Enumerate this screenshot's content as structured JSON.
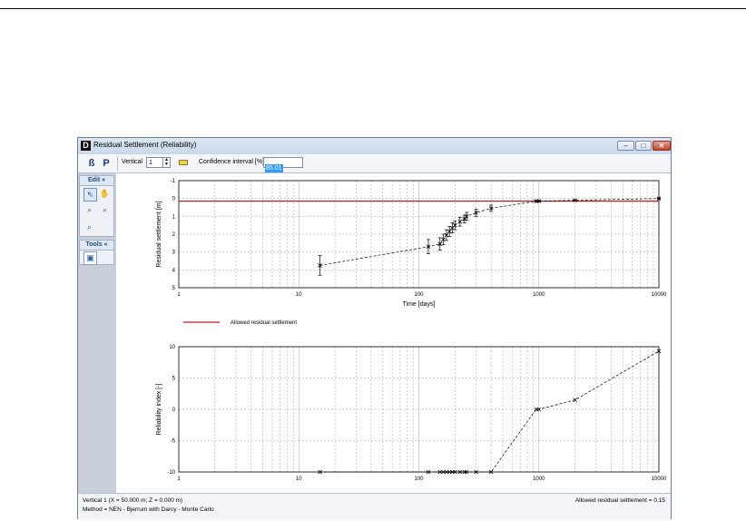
{
  "window": {
    "title": "Residual Settlement (Reliability)",
    "app_letter": "D"
  },
  "toolbar": {
    "btn1": "ß",
    "btn2": "P",
    "vertical_label": "Vertical",
    "vertical_value": "1",
    "confidence_label": "Confidence interval [%]",
    "confidence_value": "85.01"
  },
  "side": {
    "edit_title": "Edit",
    "tools_title": "Tools",
    "collapse_glyph": "«"
  },
  "status": {
    "line1": "Vertical 1 (X = 50.000 m; Z = 0.000 m)",
    "line2": "Method = NEN - Bjerrum with Darcy - Monte Carlo",
    "right": "Allowed residual settlement = 0.15"
  },
  "colors": {
    "allowed_line": "#b22222",
    "data_line": "#000000",
    "grid": "#a0a0a0"
  },
  "chart_data": [
    {
      "type": "line",
      "x_scale": "log",
      "xlabel": "Time [days]",
      "ylabel": "Residual settlement [m]",
      "xlim": [
        1,
        10000
      ],
      "ylim": [
        -1,
        5
      ],
      "y_inverted": true,
      "x_ticks": [
        "1",
        "10",
        "100",
        "1000",
        "10000"
      ],
      "y_ticks": [
        "-1",
        "0",
        "1",
        "2",
        "3",
        "4",
        "5"
      ],
      "grid": true,
      "legend": [
        {
          "name": "Allowed residual settlement",
          "color": "#b22222"
        }
      ],
      "horizontal_line": {
        "name": "Allowed residual settlement",
        "y": 0.15
      },
      "series": [
        {
          "x": [
            15,
            120,
            150,
            160,
            170,
            180,
            190,
            200,
            220,
            240,
            250,
            300,
            400,
            950,
            1000,
            2000,
            10000
          ],
          "y": [
            3.75,
            2.7,
            2.55,
            2.3,
            2.05,
            1.85,
            1.65,
            1.5,
            1.3,
            1.15,
            1.0,
            0.8,
            0.55,
            0.15,
            0.15,
            0.1,
            0.0
          ],
          "err": [
            0.55,
            0.4,
            0.35,
            0.3,
            0.3,
            0.28,
            0.28,
            0.25,
            0.25,
            0.22,
            0.22,
            0.2,
            0.18,
            0.05,
            0.05,
            0.03,
            0.02
          ]
        }
      ]
    },
    {
      "type": "line",
      "x_scale": "log",
      "xlabel": "",
      "ylabel": "Reliability index [-]",
      "xlim": [
        1,
        10000
      ],
      "ylim": [
        -10,
        10
      ],
      "x_ticks": [
        "1",
        "10",
        "100",
        "1000",
        "10000"
      ],
      "y_ticks": [
        "10",
        "5",
        "0",
        "-5",
        "-10"
      ],
      "grid": true,
      "series": [
        {
          "x": [
            15,
            120,
            150,
            160,
            170,
            180,
            190,
            200,
            220,
            240,
            250,
            300,
            400,
            950,
            1000,
            2000,
            10000
          ],
          "y": [
            -10,
            -10,
            -10,
            -10,
            -10,
            -10,
            -10,
            -10,
            -10,
            -10,
            -10,
            -10,
            -10,
            0,
            0,
            1.5,
            9.3
          ]
        }
      ]
    }
  ]
}
